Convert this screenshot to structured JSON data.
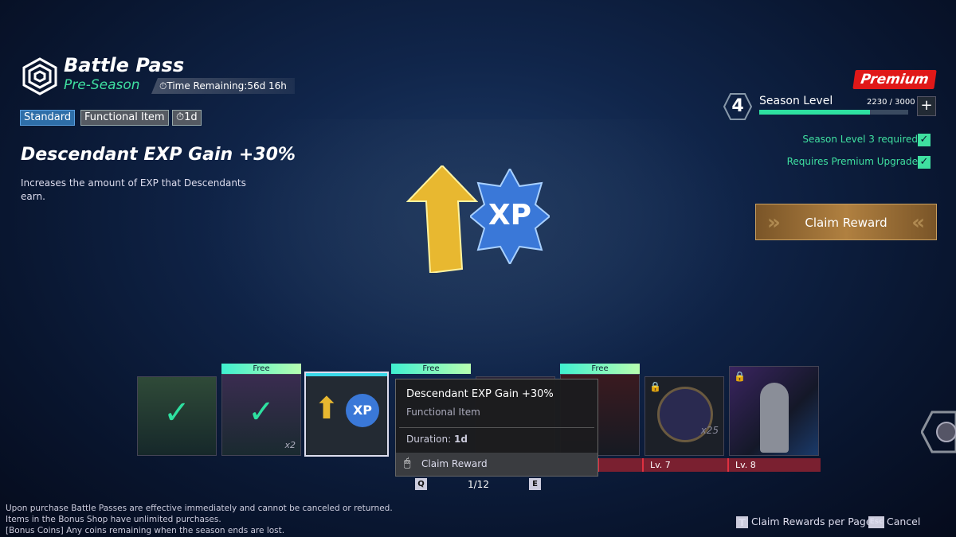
{
  "header": {
    "title": "Battle Pass",
    "season": "Pre-Season",
    "time_remaining": "Time Remaining:56d 16h"
  },
  "tags": [
    "Standard",
    "Functional Item",
    "1d"
  ],
  "item": {
    "name": "Descendant EXP Gain +30%",
    "description": "Increases the amount of EXP that Descendants earn.",
    "art_label": "XP"
  },
  "season": {
    "badge": "Premium",
    "level": "4",
    "label": "Season Level",
    "progress_text": "2230 / 3000",
    "progress": 0.7433,
    "plus": "+"
  },
  "requirements": [
    "Season Level 3 required",
    "Requires Premium Upgrade"
  ],
  "claim_button": "Claim Reward",
  "rewards": {
    "free_label": "Free",
    "counts": {
      "x2": "x2",
      "x25": "x25"
    },
    "levels": [
      "Lv. 7",
      "Lv. 8"
    ],
    "xp": "XP"
  },
  "tooltip": {
    "title": "Descendant EXP Gain +30%",
    "type": "Functional Item",
    "duration_label": "Duration:",
    "duration": "1d",
    "action": "Claim Reward"
  },
  "pager": {
    "prev_key": "Q",
    "page": "1/12",
    "next_key": "E"
  },
  "footer": {
    "notice1": "Upon purchase Battle Passes are effective immediately and cannot be canceled or returned. Items in the Bonus Shop have unlimited purchases.",
    "notice2": "[Bonus Coins] Any coins remaining when the season ends are lost."
  },
  "hints": {
    "t_key": "T",
    "t_label": "Claim Rewards per Page",
    "esc_key": "Esc",
    "esc_label": "Cancel"
  },
  "colors": {
    "accent_green": "#3fe0a0",
    "premium_red": "#e01818",
    "level_bar": "#7a2030"
  }
}
